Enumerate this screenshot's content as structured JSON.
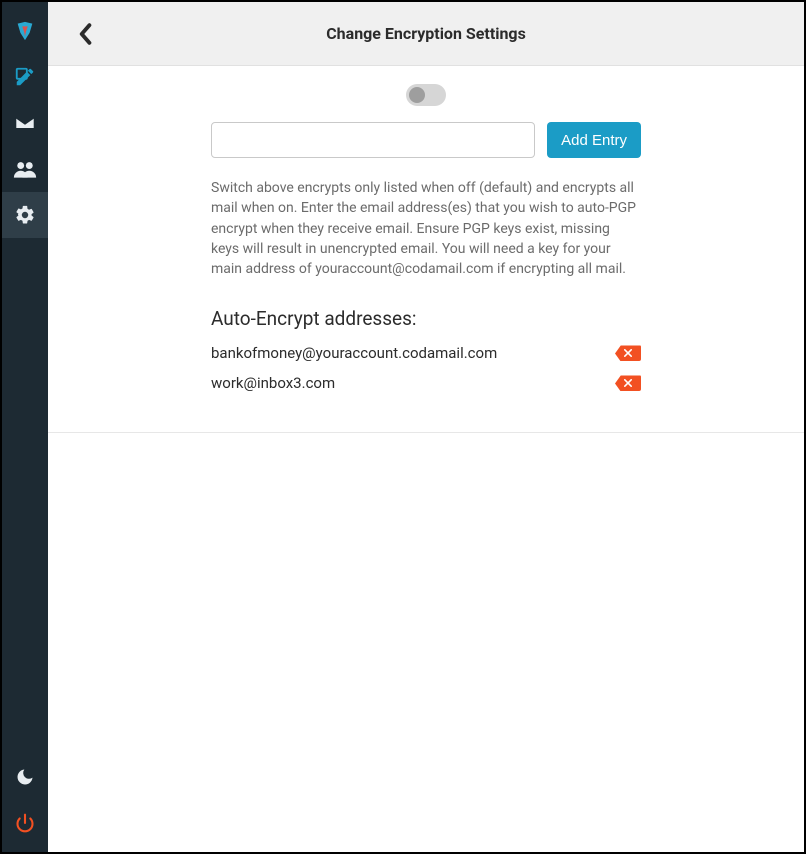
{
  "sidebar": {
    "items": [
      {
        "name": "logo"
      },
      {
        "name": "compose"
      },
      {
        "name": "mail"
      },
      {
        "name": "contacts"
      },
      {
        "name": "settings"
      }
    ],
    "bottom": [
      {
        "name": "dark-mode"
      },
      {
        "name": "power"
      }
    ]
  },
  "header": {
    "title": "Change Encryption Settings"
  },
  "form": {
    "toggle_on": false,
    "input_value": "",
    "add_label": "Add Entry",
    "helper": "Switch above encrypts only listed when off (default) and encrypts all mail when on. Enter the email address(es) that you wish to auto-PGP encrypt when they receive email. Ensure PGP keys exist, missing keys will result in unencrypted email. You will need a key for your main address of youraccount@codamail.com if encrypting all mail."
  },
  "list": {
    "heading": "Auto-Encrypt addresses:",
    "entries": [
      "bankofmoney@youraccount.codamail.com",
      "work@inbox3.com"
    ]
  }
}
